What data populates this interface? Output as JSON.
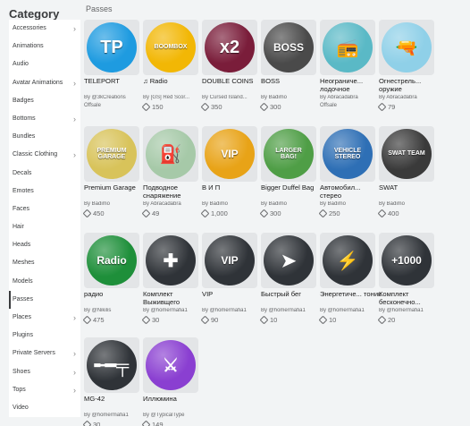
{
  "sidebar": {
    "title": "Category",
    "items": [
      {
        "label": "Accessories",
        "chevron": true
      },
      {
        "label": "Animations",
        "chevron": false
      },
      {
        "label": "Audio",
        "chevron": false
      },
      {
        "label": "Avatar Animations",
        "chevron": true
      },
      {
        "label": "Badges",
        "chevron": false
      },
      {
        "label": "Bottoms",
        "chevron": true
      },
      {
        "label": "Bundles",
        "chevron": false
      },
      {
        "label": "Classic Clothing",
        "chevron": true
      },
      {
        "label": "Decals",
        "chevron": false
      },
      {
        "label": "Emotes",
        "chevron": false
      },
      {
        "label": "Faces",
        "chevron": false
      },
      {
        "label": "Hair",
        "chevron": false
      },
      {
        "label": "Heads",
        "chevron": false
      },
      {
        "label": "Meshes",
        "chevron": false
      },
      {
        "label": "Models",
        "chevron": false
      },
      {
        "label": "Passes",
        "chevron": false,
        "active": true
      },
      {
        "label": "Places",
        "chevron": true
      },
      {
        "label": "Plugins",
        "chevron": false
      },
      {
        "label": "Private Servers",
        "chevron": true
      },
      {
        "label": "Shoes",
        "chevron": true
      },
      {
        "label": "Tops",
        "chevron": true
      },
      {
        "label": "Video",
        "chevron": false
      }
    ]
  },
  "main": {
    "section_title": "Passes",
    "items": [
      {
        "name": "TELEPORT",
        "creator": "By @3kCreations",
        "price": "",
        "offsale": "Offsale",
        "art": "TP",
        "bg": "#1e9be0",
        "icon": "teleport-icon"
      },
      {
        "name": "Radio",
        "creator": "By [GS] Red Scor...",
        "price": "150",
        "offsale": "",
        "art": "BOOMBOX",
        "bg": "#f2b705",
        "icon": "boombox-icon",
        "music_glyph": "♫"
      },
      {
        "name": "DOUBLE COINS",
        "creator": "By Cursed Island...",
        "price": "350",
        "offsale": "",
        "art": "x2",
        "bg": "#7a1d3a",
        "icon": "coins-icon"
      },
      {
        "name": "BOSS",
        "creator": "By Badimo",
        "price": "300",
        "offsale": "",
        "art": "BOSS",
        "bg": "#4a4a4a",
        "icon": "boss-icon"
      },
      {
        "name": "Неограниче... лодочное",
        "creator": "By Abracadabra",
        "price": "",
        "offsale": "Offsale",
        "art": "",
        "bg": "#5ab9c6",
        "icon": "radio-icon"
      },
      {
        "name": "Огнестрель... оружие",
        "creator": "By Abracadabra",
        "price": "79",
        "offsale": "",
        "art": "",
        "bg": "#8fd0e8",
        "icon": "flare-gun-icon"
      },
      {
        "name": "Premium Garage",
        "creator": "By Badimo",
        "price": "450",
        "offsale": "",
        "art": "PREMIUM GARAGE",
        "bg": "#d8c35a",
        "icon": "garage-icon"
      },
      {
        "name": "Подводное снаряжение",
        "creator": "By Abracadabra",
        "price": "49",
        "offsale": "",
        "art": "",
        "bg": "#a6c9a8",
        "icon": "scuba-tank-icon"
      },
      {
        "name": "В И П",
        "creator": "By Badimo",
        "price": "1,000",
        "offsale": "",
        "art": "VIP",
        "bg": "#e8a317",
        "icon": "vip-icon"
      },
      {
        "name": "Bigger Duffel Bag",
        "creator": "By Badimo",
        "price": "300",
        "offsale": "",
        "art": "LARGER BAG!",
        "bg": "#4f9e46",
        "icon": "duffel-bag-icon"
      },
      {
        "name": "Автомобил... стерео",
        "creator": "By Badimo",
        "price": "250",
        "offsale": "",
        "art": "VEHICLE STEREO",
        "bg": "#2e6fb5",
        "icon": "stereo-icon"
      },
      {
        "name": "SWAT",
        "creator": "By Badimo",
        "price": "400",
        "offsale": "",
        "art": "SWAT TEAM",
        "bg": "#3a3a3a",
        "icon": "swat-icon"
      },
      {
        "name": "радио",
        "creator": "By @Nikilis",
        "price": "475",
        "offsale": "",
        "art": "Radio",
        "bg": "#1e8f3a",
        "icon": "radio-icon"
      },
      {
        "name": "Комплект Выживщего",
        "creator": "By @homermafia1",
        "price": "30",
        "offsale": "",
        "art": "",
        "bg": "#2f3338",
        "icon": "survival-kit-icon"
      },
      {
        "name": "VIP",
        "creator": "By @homermafia1",
        "price": "90",
        "offsale": "",
        "art": "VIP",
        "bg": "#2f3338",
        "icon": "vip-icon"
      },
      {
        "name": "Быстрый бег",
        "creator": "By @homermafia1",
        "price": "10",
        "offsale": "",
        "art": "",
        "bg": "#2f3338",
        "icon": "speed-icon"
      },
      {
        "name": "Энергетиче... тоник",
        "creator": "By @homermafia1",
        "price": "10",
        "offsale": "",
        "art": "",
        "bg": "#2f3338",
        "icon": "energy-drink-icon"
      },
      {
        "name": "Комплект бесконечно...",
        "creator": "By @homermafia1",
        "price": "20",
        "offsale": "",
        "art": "+1000",
        "bg": "#2f3338",
        "icon": "ammo-icon"
      },
      {
        "name": "MG-42",
        "creator": "By @homermafia1",
        "price": "30",
        "offsale": "",
        "art": "",
        "bg": "#2f3338",
        "icon": "machine-gun-icon"
      },
      {
        "name": "Иллюмина",
        "creator": "By @TypicalType",
        "price": "149",
        "offsale": "",
        "art": "",
        "bg": "#8a3fd1",
        "icon": "sword-icon"
      }
    ]
  }
}
